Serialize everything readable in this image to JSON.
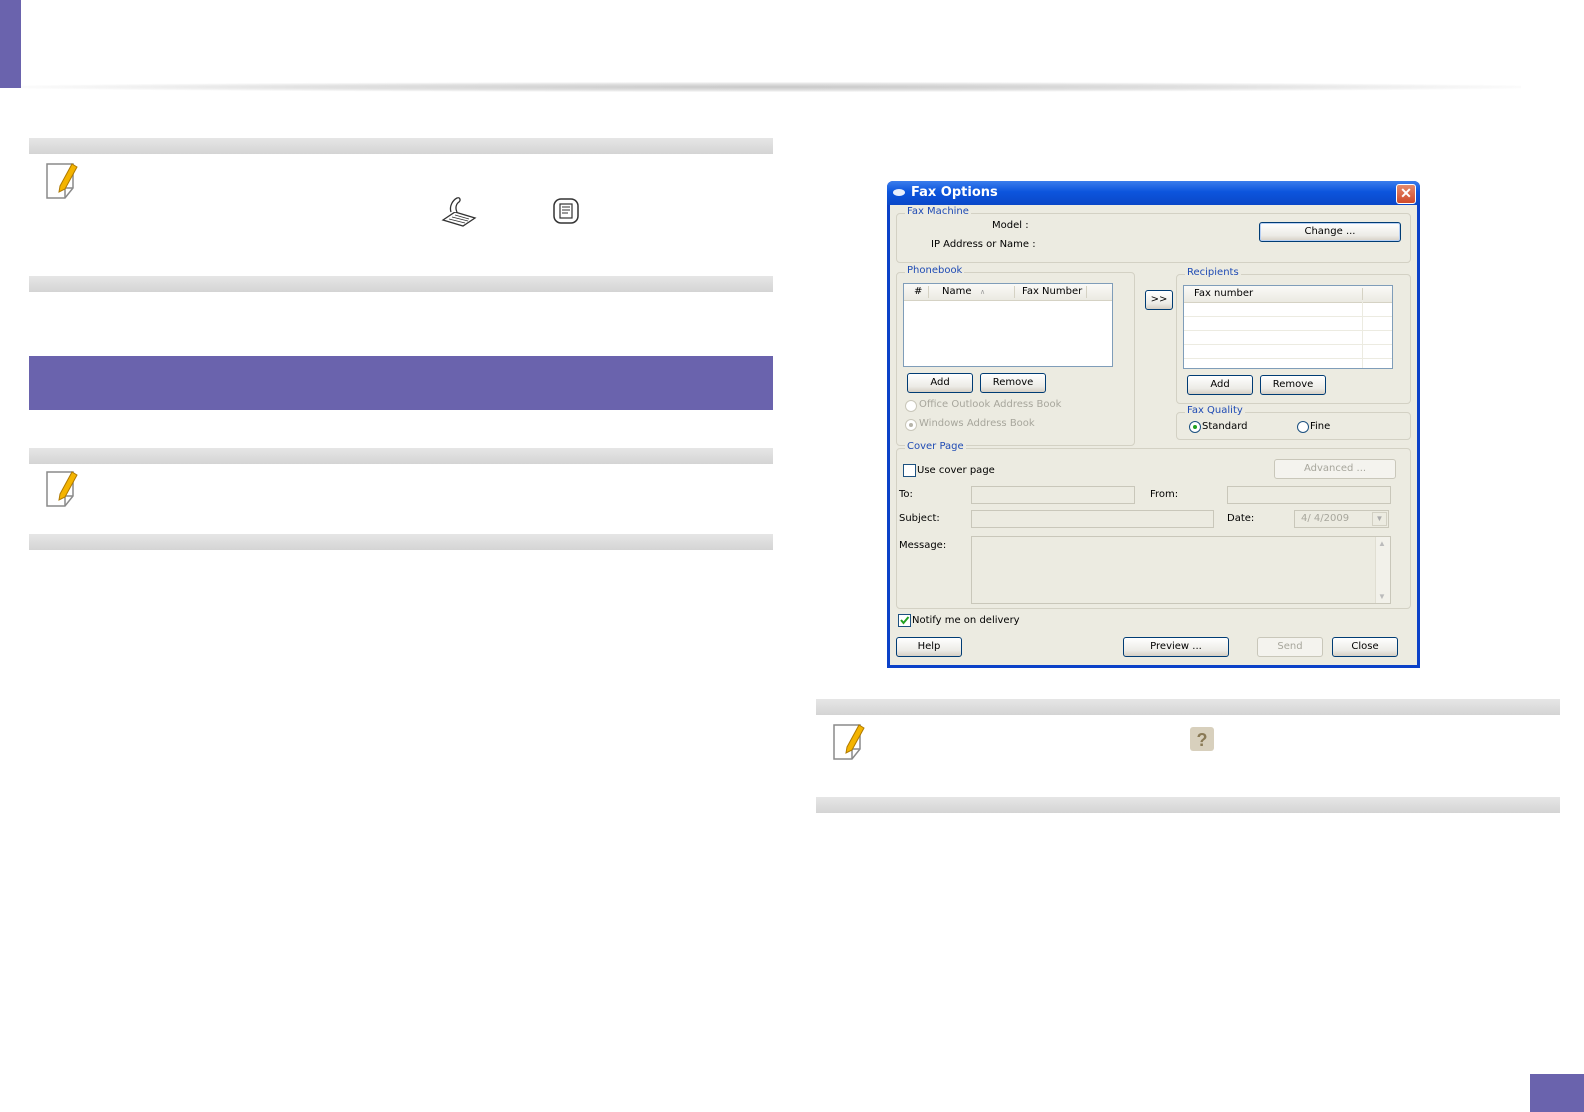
{
  "dialog": {
    "title": "Fax Options",
    "close_glyph": "✕",
    "fax_machine": {
      "group_label": "Fax Machine",
      "model_label": "Model :",
      "ip_label": "IP Address or Name :",
      "change_button": "Change ..."
    },
    "phonebook": {
      "group_label": "Phonebook",
      "columns": [
        "#",
        "Name",
        "Fax Number"
      ],
      "sort_indicator": "∧",
      "add_button": "Add",
      "remove_button": "Remove",
      "outlook_option": "Office Outlook Address Book",
      "windows_option": "Windows Address Book"
    },
    "transfer_button": ">>",
    "recipients": {
      "group_label": "Recipients",
      "column": "Fax number",
      "add_button": "Add",
      "remove_button": "Remove"
    },
    "fax_quality": {
      "group_label": "Fax Quality",
      "standard": "Standard",
      "fine": "Fine",
      "selected": "Standard"
    },
    "cover_page": {
      "group_label": "Cover Page",
      "use_cover_page": "Use cover page",
      "advanced_button": "Advanced ...",
      "to_label": "To:",
      "from_label": "From:",
      "subject_label": "Subject:",
      "date_label": "Date:",
      "date_value": "4/ 4/2009",
      "message_label": "Message:"
    },
    "notify": "Notify me on delivery",
    "buttons": {
      "help": "Help",
      "preview": "Preview ...",
      "send": "Send",
      "close": "Close"
    }
  },
  "colors": {
    "accent": "#6a63ad",
    "dialog_frame": "#0b41c8",
    "group_label": "#1f4bb4"
  },
  "icons": [
    "note-icon",
    "fax-handset-icon",
    "phonebook-button-icon",
    "help-question-icon"
  ]
}
